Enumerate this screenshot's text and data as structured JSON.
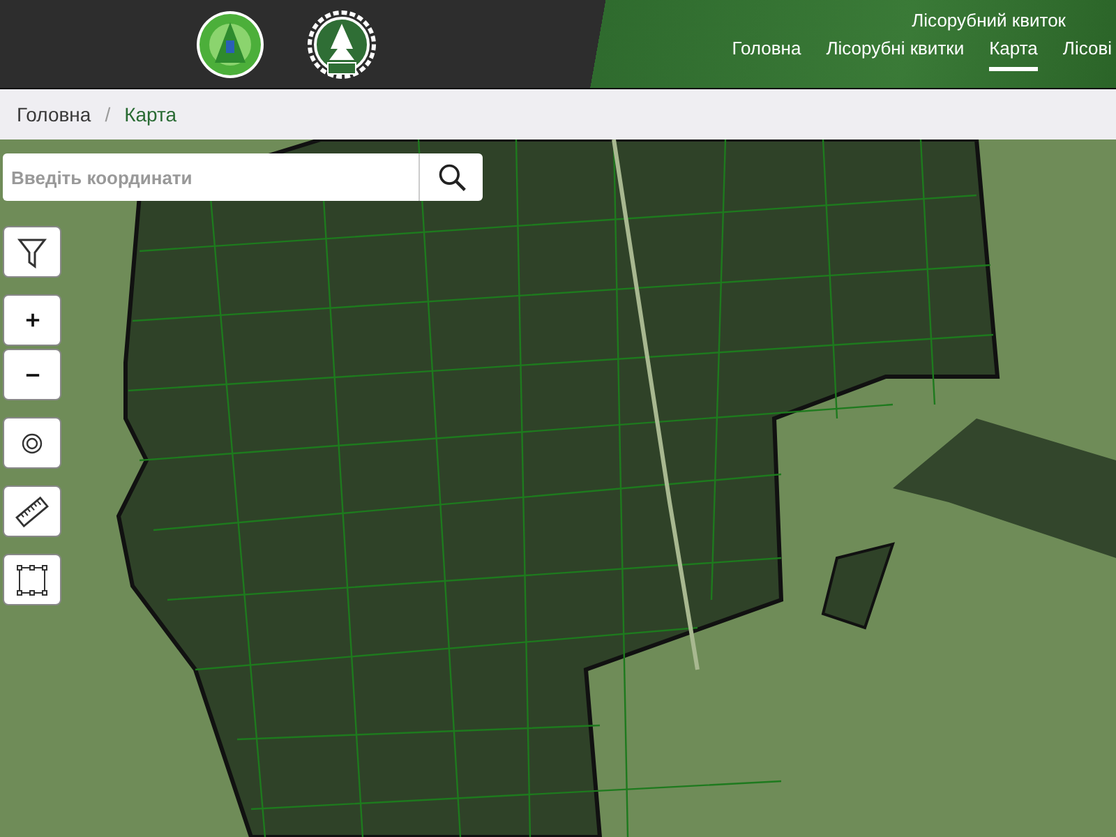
{
  "header": {
    "site_title": "Лісорубний квиток",
    "nav": [
      {
        "label": "Головна",
        "selected": false
      },
      {
        "label": "Лісорубні квитки",
        "selected": false
      },
      {
        "label": "Карта",
        "selected": true
      },
      {
        "label": "Лісові",
        "selected": false
      }
    ]
  },
  "breadcrumb_separator": "/",
  "breadcrumb": [
    {
      "label": "Головна",
      "kind": "link"
    },
    {
      "label": "Карта",
      "kind": "current"
    }
  ],
  "map": {
    "search": {
      "placeholder": "Введіть координати"
    }
  }
}
